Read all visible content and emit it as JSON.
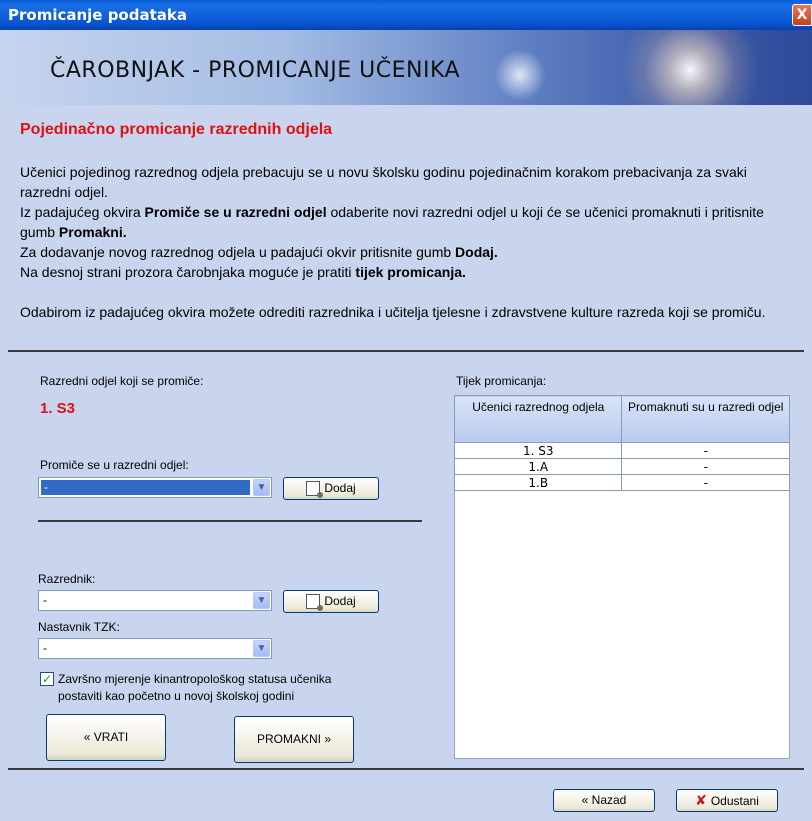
{
  "window": {
    "title": "Promicanje podataka",
    "close_label": "X"
  },
  "banner": {
    "title": "ČAROBNJAK - PROMICANJE UČENIKA"
  },
  "section": {
    "heading": "Pojedinačno promicanje razrednih odjela"
  },
  "intro": {
    "line1": "Učenici pojedinog razrednog odjela prebacuju se u novu školsku godinu pojedinačnim korakom prebacivanja za svaki razredni odjel.",
    "line2_pre": "Iz padajućeg okvira ",
    "line2_bold": "Promiče se u razredni odjel",
    "line2_post": " odaberite novi razredni odjel u koji će se učenici promaknuti i pritisnite gumb ",
    "line2_bold2": "Promakni.",
    "line3_pre": "Za dodavanje novog razrednog odjela u padajući okvir pritisnite gumb ",
    "line3_bold": "Dodaj.",
    "line4_pre": "Na desnoj strani prozora čarobnjaka moguće je pratiti ",
    "line4_bold": "tijek promicanja.",
    "line5": "Odabirom iz padajućeg okvira možete odrediti razrednika i učitelja tjelesne i zdravstvene kulture razreda koji se promiču."
  },
  "left": {
    "current_label": "Razredni odjel koji se promiče:",
    "current_value": "1. S3",
    "target_label": "Promiče se u razredni odjel:",
    "target_value": "-",
    "add_label": "Dodaj",
    "teacher_label": "Razrednik:",
    "teacher_value": "-",
    "pe_label": "Nastavnik TZK:",
    "pe_value": "-",
    "checkbox_label": "Završno mjerenje kinantropološkog statusa učenika postaviti kao početno u novoj školskoj godini",
    "checkbox_mark": "✓",
    "back_button": "« VRATI",
    "promote_button": "PROMAKNI »"
  },
  "right": {
    "progress_label": "Tijek promicanja:",
    "columns": [
      "Učenici razrednog odjela",
      "Promaknuti su u razredi odjel"
    ],
    "rows": [
      [
        "1. S3",
        "-"
      ],
      [
        "1.A",
        "-"
      ],
      [
        "1.B",
        "-"
      ]
    ]
  },
  "footer": {
    "back_label": "« Nazad",
    "cancel_label": "Odustani"
  },
  "icons": {
    "dropdown": "chevron-down-icon",
    "add": "add-document-icon",
    "cancel": "x-icon"
  }
}
